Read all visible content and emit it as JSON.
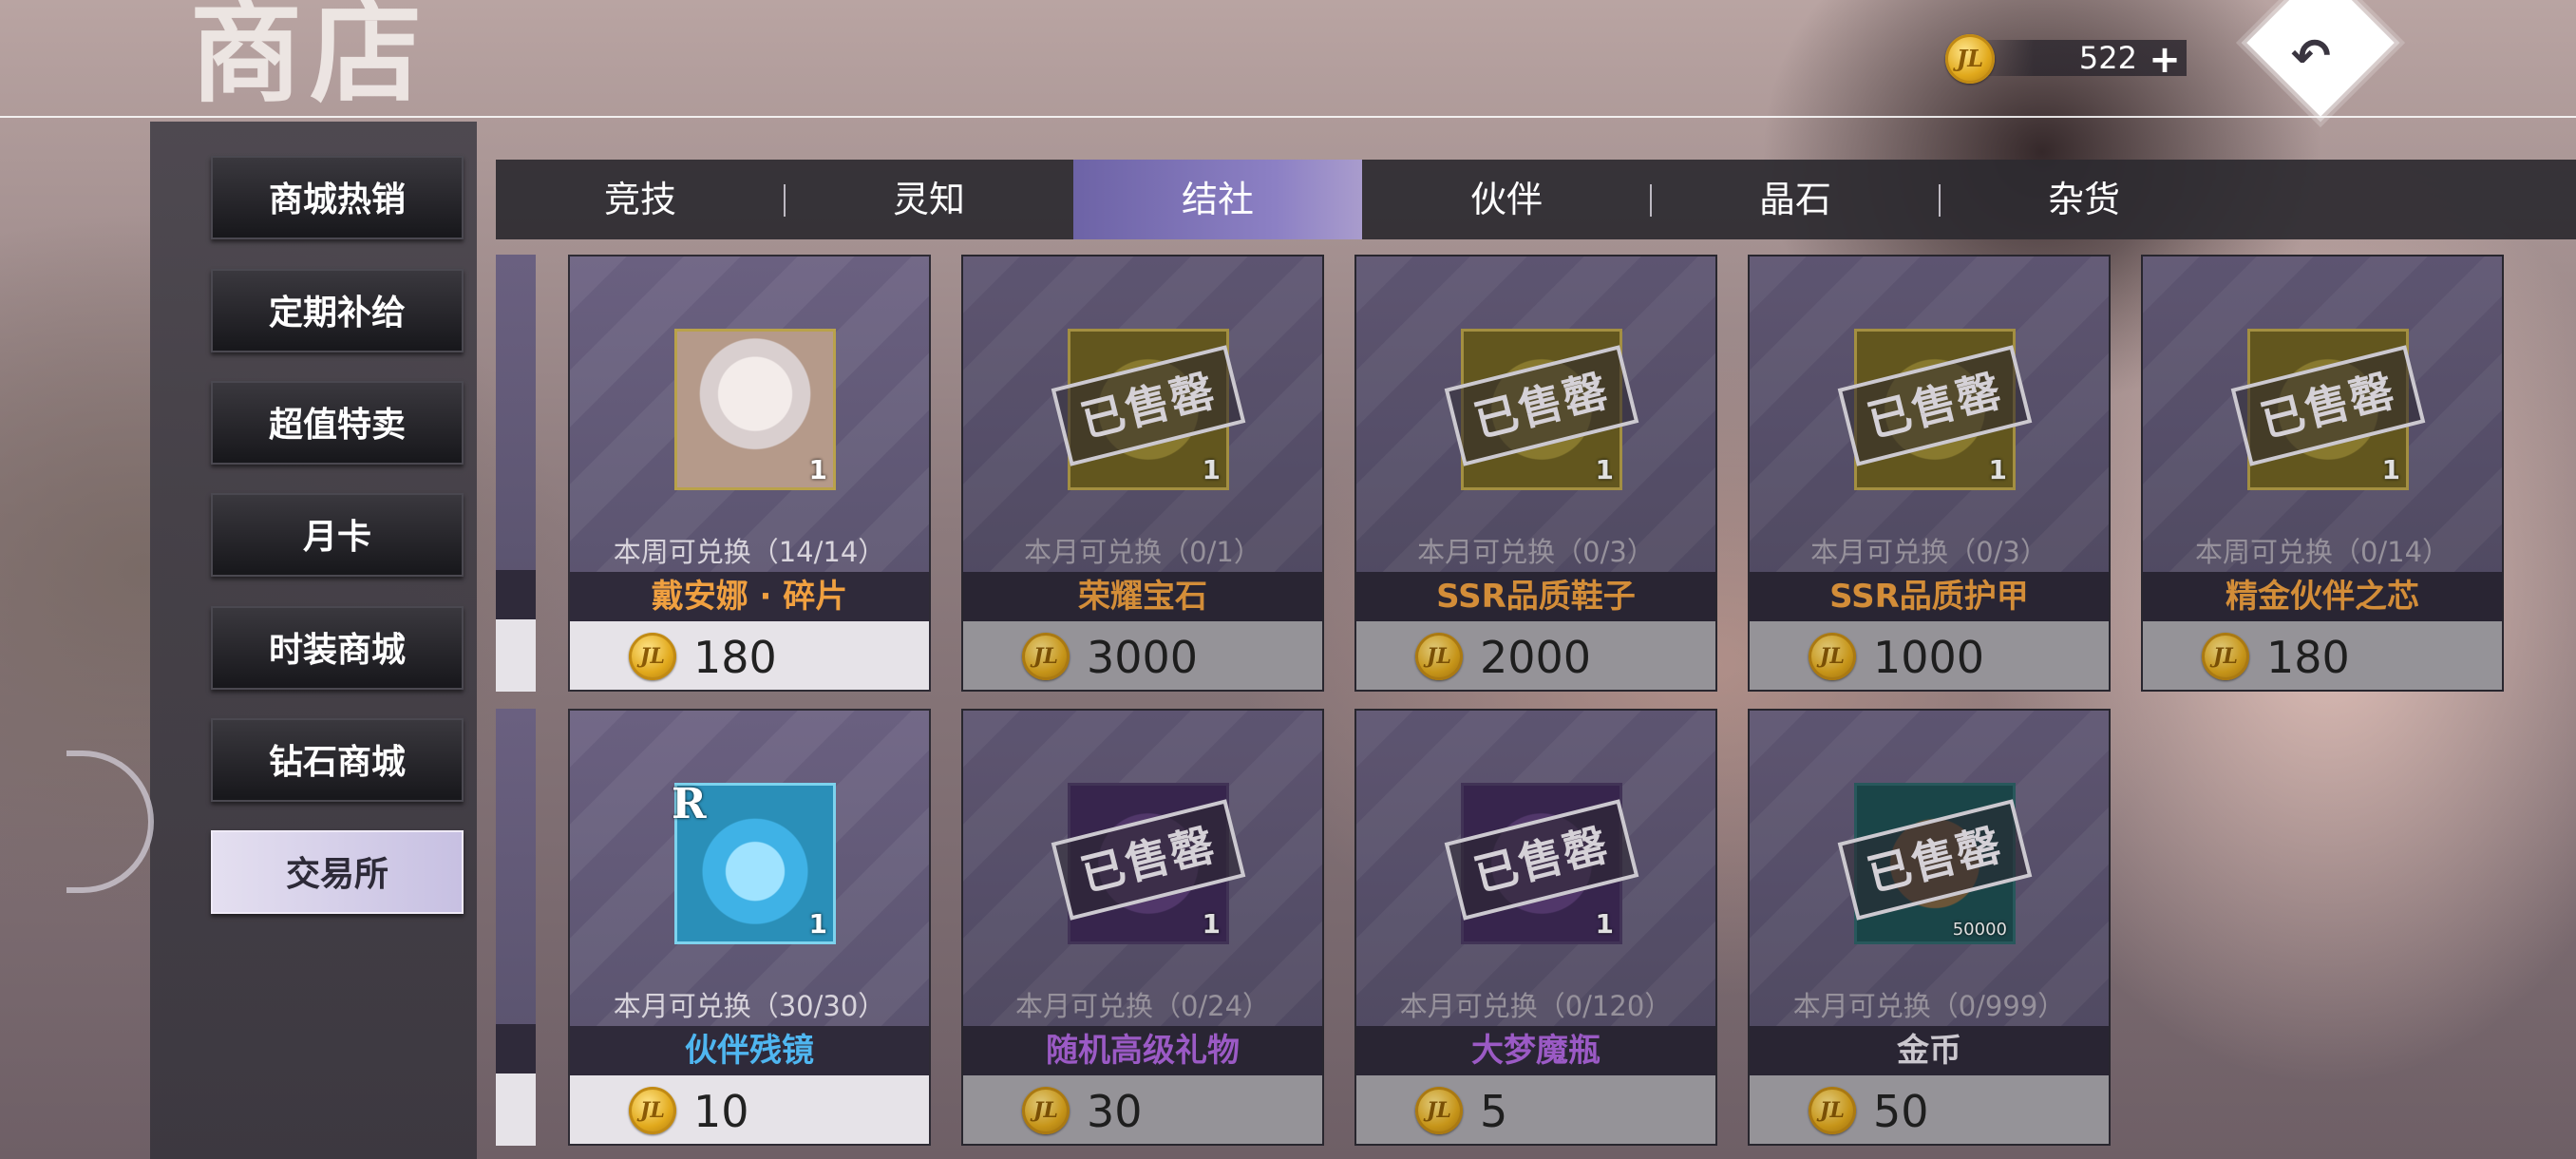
{
  "header": {
    "title": "商店"
  },
  "currency": {
    "coin_glyph": "JL",
    "amount": "522",
    "plus_label": "+"
  },
  "back_glyph": "↶",
  "sidebar": {
    "items": [
      {
        "label": "商城热销",
        "active": false
      },
      {
        "label": "定期补给",
        "active": false
      },
      {
        "label": "超值特卖",
        "active": false
      },
      {
        "label": "月卡",
        "active": false
      },
      {
        "label": "时装商城",
        "active": false
      },
      {
        "label": "钻石商城",
        "active": false
      },
      {
        "label": "交易所",
        "active": true
      }
    ]
  },
  "tabs": [
    {
      "label": "竞技",
      "active": false
    },
    {
      "label": "灵知",
      "active": false
    },
    {
      "label": "结社",
      "active": true
    },
    {
      "label": "伙伴",
      "active": false
    },
    {
      "label": "晶石",
      "active": false
    },
    {
      "label": "杂货",
      "active": false
    }
  ],
  "sold_out_label": "已售罄",
  "items": [
    {
      "name": "戴安娜 · 碎片",
      "limit": "本周可兑换（14/14）",
      "price": "180",
      "qty": "1",
      "sold_out": false,
      "name_color": "#f0a040",
      "art": "portrait"
    },
    {
      "name": "荣耀宝石",
      "limit": "本月可兑换（0/1）",
      "price": "3000",
      "qty": "1",
      "sold_out": true,
      "name_color": "#f0a040",
      "art": "gold"
    },
    {
      "name": "SSR品质鞋子",
      "limit": "本月可兑换（0/3）",
      "price": "2000",
      "qty": "1",
      "sold_out": true,
      "name_color": "#f0a040",
      "art": "gold"
    },
    {
      "name": "SSR品质护甲",
      "limit": "本月可兑换（0/3）",
      "price": "1000",
      "qty": "1",
      "sold_out": true,
      "name_color": "#f0a040",
      "art": "gold"
    },
    {
      "name": "精金伙伴之芯",
      "limit": "本周可兑换（0/14）",
      "price": "180",
      "qty": "1",
      "sold_out": true,
      "name_color": "#f0a040",
      "art": "gold"
    },
    {
      "name": "伙伴残镜",
      "limit": "本月可兑换（30/30）",
      "price": "10",
      "qty": "1",
      "sold_out": false,
      "name_color": "#4fb6f0",
      "art": "crystal",
      "rarity": "R"
    },
    {
      "name": "随机高级礼物",
      "limit": "本月可兑换（0/24）",
      "price": "30",
      "qty": "1",
      "sold_out": true,
      "name_color": "#b066e0",
      "art": "purple"
    },
    {
      "name": "大梦魔瓶",
      "limit": "本月可兑换（0/120）",
      "price": "5",
      "qty": "1",
      "sold_out": true,
      "name_color": "#b066e0",
      "art": "purple"
    },
    {
      "name": "金币",
      "limit": "本月可兑换（0/999）",
      "price": "50",
      "qty": "50000",
      "sold_out": true,
      "name_color": "#e6e2ea",
      "art": "teal"
    }
  ]
}
